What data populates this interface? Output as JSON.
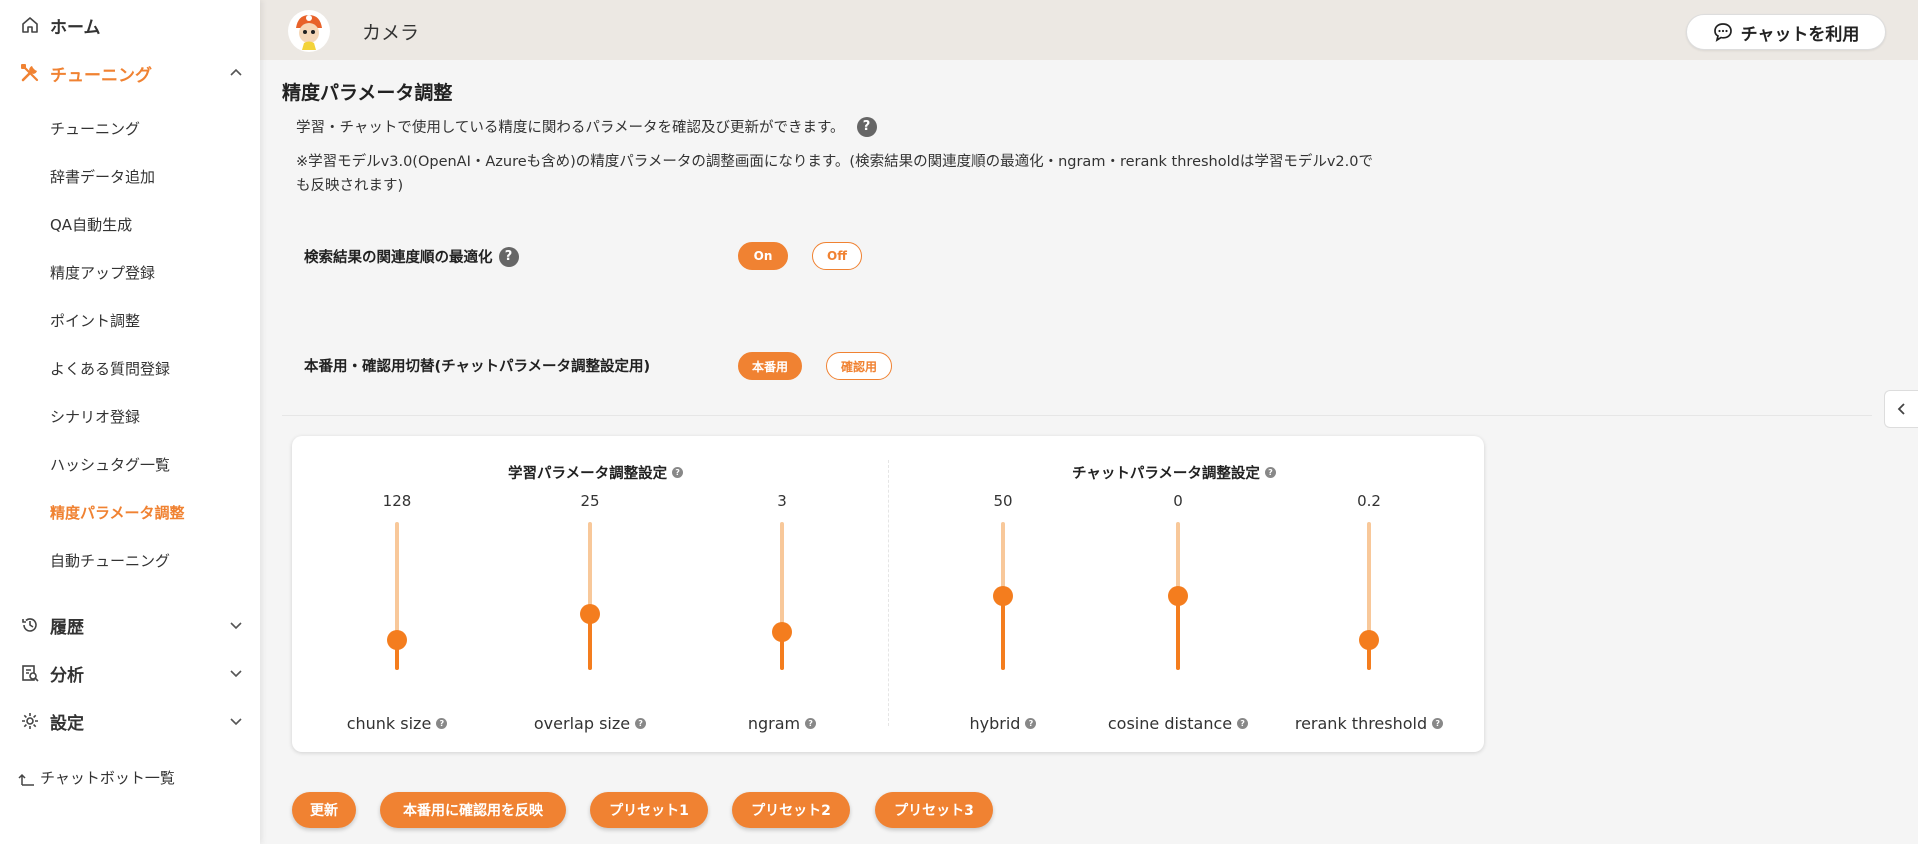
{
  "sidebar": {
    "home": "ホーム",
    "tuning": "チューニング",
    "sub_items": [
      "チューニング",
      "辞書データ追加",
      "QA自動生成",
      "精度アップ登録",
      "ポイント調整",
      "よくある質問登録",
      "シナリオ登録",
      "ハッシュタグ一覧",
      "精度パラメータ調整",
      "自動チューニング"
    ],
    "active_sub": "精度パラメータ調整",
    "history": "履歴",
    "analysis": "分析",
    "settings": "設定",
    "back_link": "チャットボット一覧"
  },
  "header": {
    "title": "カメラ",
    "chat_button": "チャットを利用"
  },
  "main": {
    "title": "精度パラメータ調整",
    "description": "学習・チャットで使用している精度に関わるパラメータを確認及び更新ができます。",
    "note": "※学習モデルv3.0(OpenAI・Azureも含め)の精度パラメータの調整画面になります。(検索結果の関連度順の最適化・ngram・rerank thresholdは学習モデルv2.0でも反映されます)",
    "help_glyph": "?",
    "optimize": {
      "label": "検索結果の関連度順の最適化",
      "on": "On",
      "off": "Off",
      "selected": "On"
    },
    "mode": {
      "label": "本番用・確認用切替(チャットパラメータ調整設定用)",
      "prod": "本番用",
      "confirm": "確認用",
      "selected": "本番用"
    }
  },
  "panel": {
    "learning_title": "学習パラメータ調整設定",
    "chat_title": "チャットパラメータ調整設定",
    "sliders": [
      {
        "name": "chunk size",
        "value": "128",
        "level": 0.2
      },
      {
        "name": "overlap size",
        "value": "25",
        "level": 0.38
      },
      {
        "name": "ngram",
        "value": "3",
        "level": 0.26
      },
      {
        "name": "hybrid",
        "value": "50",
        "level": 0.5
      },
      {
        "name": "cosine distance",
        "value": "0",
        "level": 0.5
      },
      {
        "name": "rerank threshold",
        "value": "0.2",
        "level": 0.2
      }
    ]
  },
  "actions": {
    "update": "更新",
    "apply": "本番用に確認用を反映",
    "preset1": "プリセット1",
    "preset2": "プリセット2",
    "preset3": "プリセット3"
  },
  "colors": {
    "accent": "#f08232",
    "slider_fill": "#f47d1e",
    "slider_track": "#f8c89a",
    "header_bg": "#ece8e3"
  }
}
